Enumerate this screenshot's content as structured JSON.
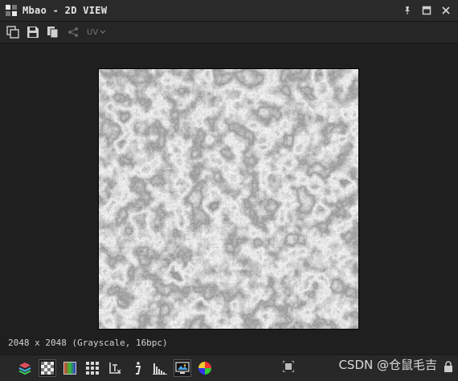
{
  "window": {
    "title": "Mbao - 2D VIEW"
  },
  "title_actions": {
    "pin_icon": "pin-icon",
    "maximize_icon": "maximize-icon",
    "close_icon": "close-icon"
  },
  "toolbar": {
    "uv_label": "UV"
  },
  "status": {
    "text": "2048 x 2048 (Grayscale, 16bpc)"
  },
  "watermark": {
    "text": "CSDN @仓鼠毛吉"
  }
}
